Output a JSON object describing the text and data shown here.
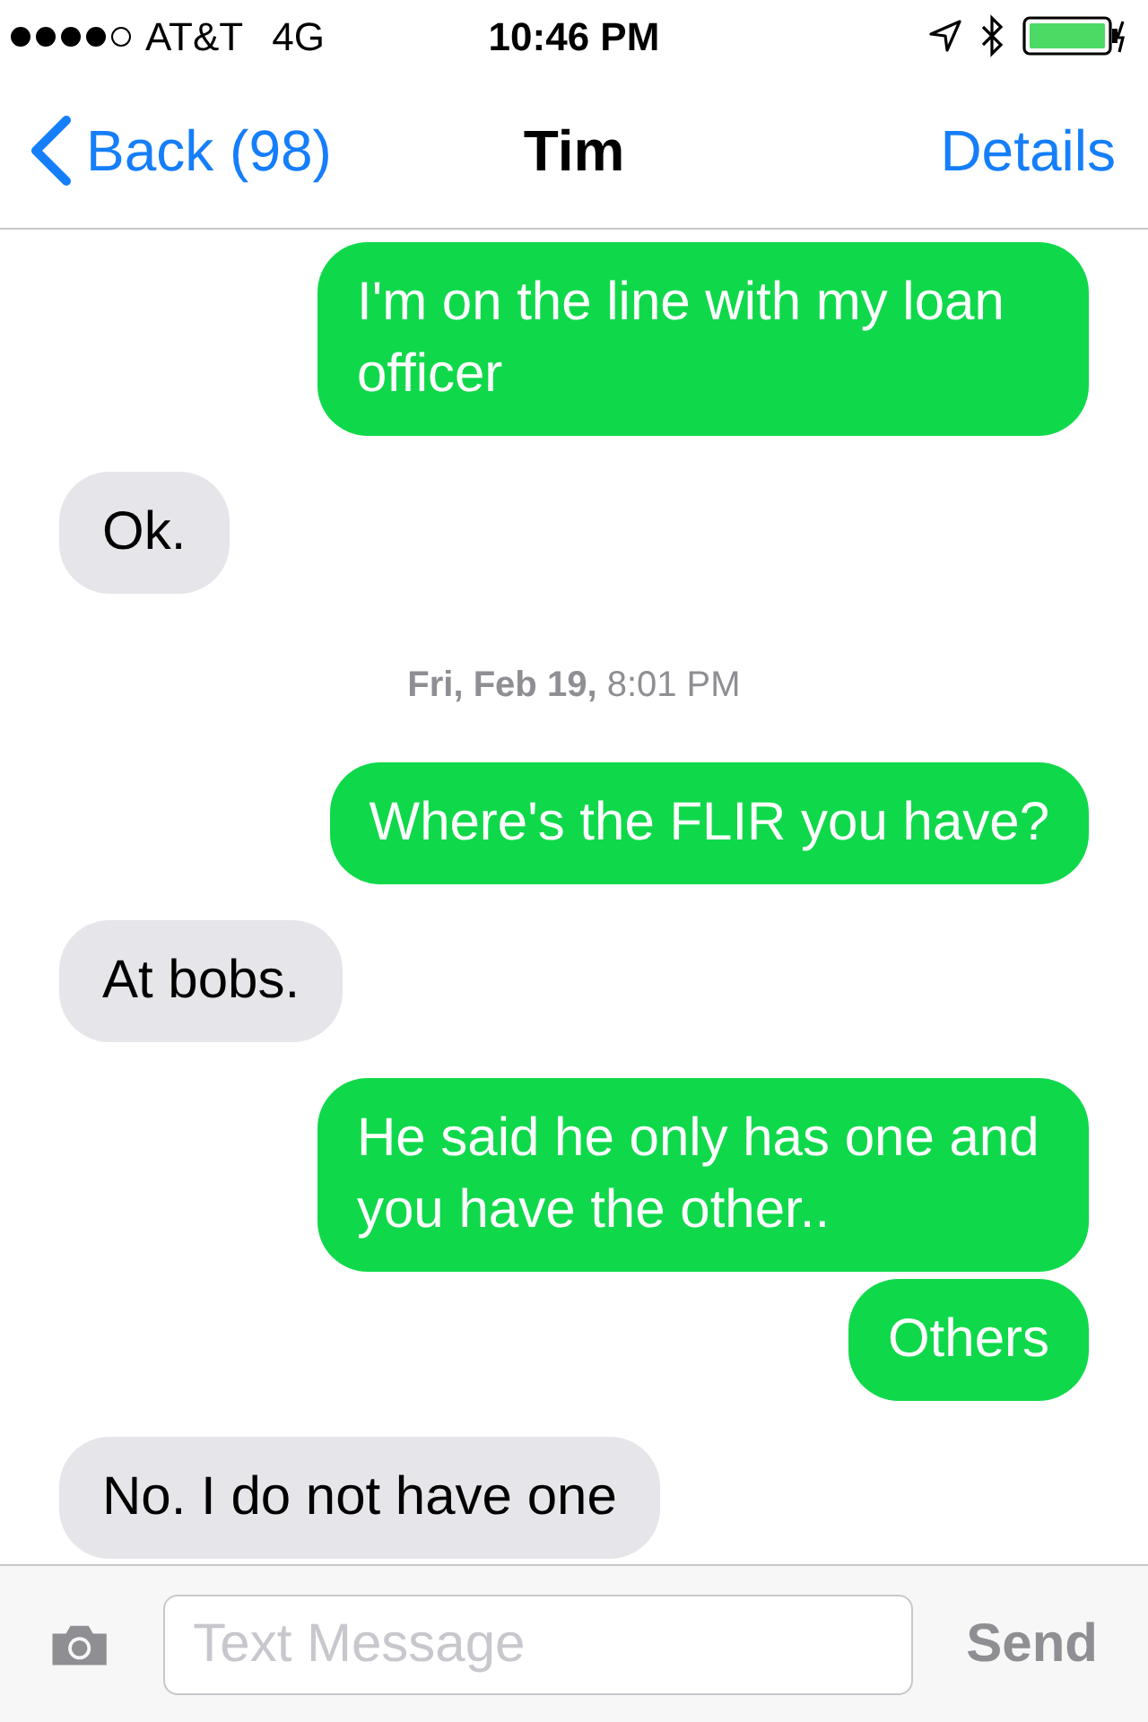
{
  "status_bar": {
    "carrier": "AT&T",
    "network": "4G",
    "time": "10:46 PM"
  },
  "nav": {
    "back": "Back (98)",
    "title": "Tim",
    "action": "Details"
  },
  "messages": [
    {
      "kind": "outgoing",
      "text": "I'm on the line with my loan officer"
    },
    {
      "kind": "incoming",
      "text": "Ok."
    },
    {
      "kind": "timestamp",
      "text": "**Fri, Feb 19,** 8:01 PM"
    },
    {
      "kind": "outgoing",
      "text": "Where's the FLIR you have?"
    },
    {
      "kind": "incoming",
      "text": "At bobs."
    },
    {
      "kind": "outgoing",
      "text": "He said he only has one and you have the other.."
    },
    {
      "kind": "outgoing",
      "text": "Others"
    },
    {
      "kind": "incoming",
      "text": "No. I do not have one"
    }
  ],
  "composer": {
    "placeholder": "Text Message",
    "send": "Send",
    "send_disabled": true
  }
}
